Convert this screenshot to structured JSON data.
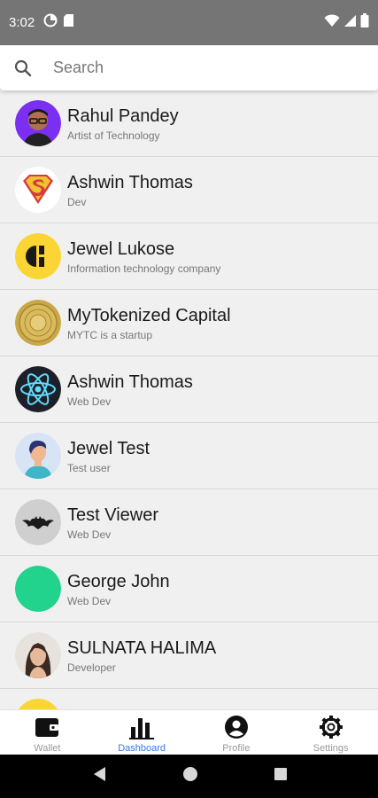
{
  "status_bar": {
    "time": "3:02",
    "left_icons": [
      "data-saver-icon",
      "sd-card-icon"
    ],
    "right_icons": [
      "wifi-icon",
      "signal-icon",
      "battery-icon"
    ]
  },
  "search": {
    "placeholder": "Search",
    "icon": "search-icon"
  },
  "contacts": [
    {
      "name": "Rahul Pandey",
      "subtitle": "Artist of Technology",
      "avatar": "photo-man-glasses"
    },
    {
      "name": "Ashwin Thomas",
      "subtitle": "Dev",
      "avatar": "superman-logo"
    },
    {
      "name": "Jewel Lukose",
      "subtitle": "Information technology company",
      "avatar": "yellow-company-logo"
    },
    {
      "name": "MyTokenized Capital",
      "subtitle": "MYTC is a startup",
      "avatar": "gold-coin"
    },
    {
      "name": "Ashwin Thomas",
      "subtitle": "Web Dev",
      "avatar": "react-logo"
    },
    {
      "name": "Jewel Test",
      "subtitle": "Test user",
      "avatar": "cartoon-man"
    },
    {
      "name": "Test Viewer",
      "subtitle": "Web Dev",
      "avatar": "batman-logo"
    },
    {
      "name": "George John",
      "subtitle": "Web Dev",
      "avatar": "green-circle"
    },
    {
      "name": "SULNATA HALIMA",
      "subtitle": "Developer",
      "avatar": "photo-woman"
    }
  ],
  "bottom_nav": {
    "items": [
      {
        "label": "Wallet",
        "icon": "wallet-icon",
        "active": false
      },
      {
        "label": "Dashboard",
        "icon": "bar-chart-icon",
        "active": true
      },
      {
        "label": "Profile",
        "icon": "account-circle-icon",
        "active": false
      },
      {
        "label": "Settings",
        "icon": "gear-icon",
        "active": false
      }
    ]
  },
  "colors": {
    "status_bar": "#757575",
    "background": "#f0f0f0",
    "accent": "#2f7bea",
    "react_blue": "#61dafb",
    "green_avatar": "#22d38d",
    "yellow_logo": "#fbd533"
  }
}
